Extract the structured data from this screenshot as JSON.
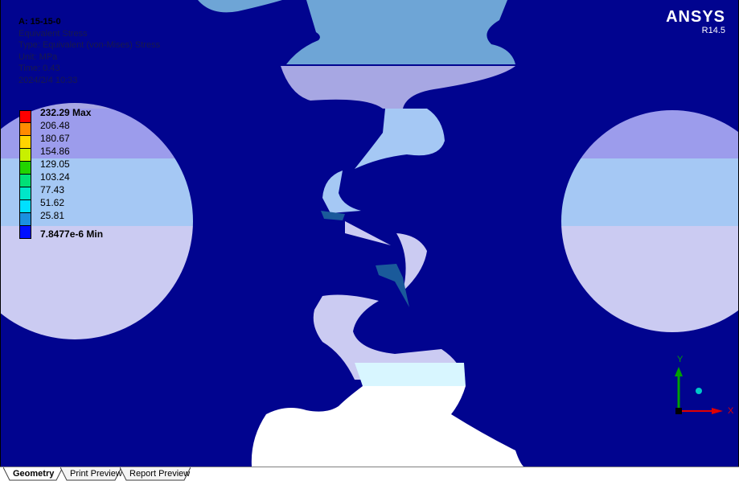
{
  "info": {
    "title": "A: 15-15-0",
    "result": "Equivalent Stress",
    "type": "Type: Equivalent (von-Mises) Stress",
    "unit": "Unit: MPa",
    "time": "Time: 0.43",
    "date": "2024/2/4 10:33"
  },
  "legend": {
    "items": [
      {
        "label": "232.29 Max",
        "color": "#ff0000",
        "bold": true
      },
      {
        "label": "206.48",
        "color": "#ff8a00"
      },
      {
        "label": "180.67",
        "color": "#ffd400"
      },
      {
        "label": "154.86",
        "color": "#c8f000"
      },
      {
        "label": "129.05",
        "color": "#22d400"
      },
      {
        "label": "103.24",
        "color": "#00e077"
      },
      {
        "label": "77.43",
        "color": "#00e6c8"
      },
      {
        "label": "51.62",
        "color": "#00e0ff"
      },
      {
        "label": "25.81",
        "color": "#1a90e0"
      }
    ],
    "min_label": "7.8477e-6 Min",
    "min_color": "#0010ff"
  },
  "brand": {
    "logo": "ANSYS",
    "version": "R14.5"
  },
  "triad": {
    "y_label": "Y",
    "x_color": "#e00000",
    "y_color": "#00a000",
    "z_color": "#00c8c8"
  },
  "tabs": [
    {
      "label": "Geometry",
      "active": true
    },
    {
      "label": "Print Preview",
      "active": false
    },
    {
      "label": "Report Preview",
      "active": false
    }
  ]
}
